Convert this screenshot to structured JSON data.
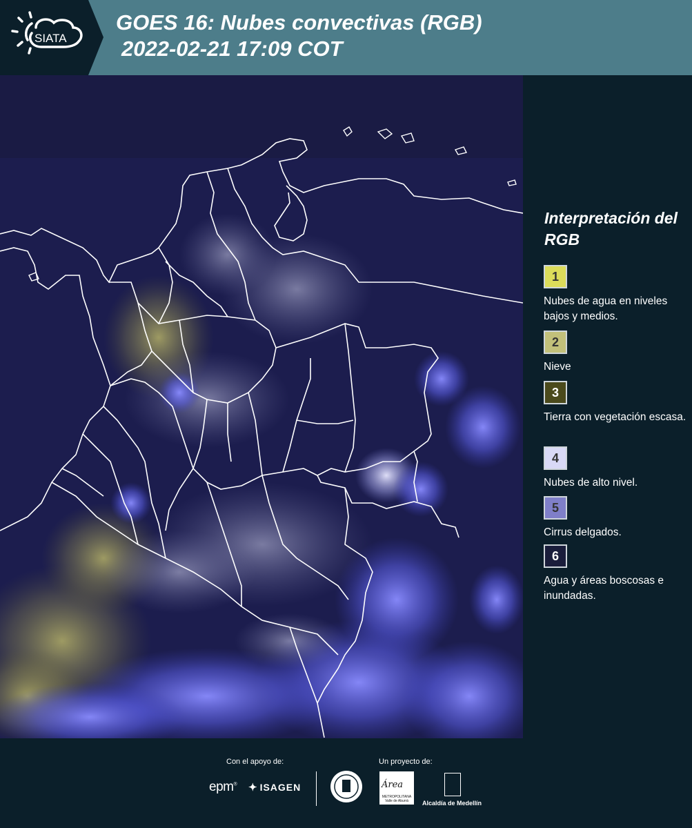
{
  "header": {
    "logo_text": "SIATA",
    "title_line1": "GOES 16: Nubes convectivas (RGB)",
    "title_line2": "2022-02-21 17:09 COT",
    "background_color": "#4d7d8a"
  },
  "map": {
    "region": "Colombia",
    "boundary_color": "#ffffff",
    "background_color": "#1b1c4c"
  },
  "legend": {
    "title": "Interpretación del RGB",
    "items": [
      {
        "number": "1",
        "color": "#dcdc5a",
        "label": "Nubes de agua en niveles bajos y medios."
      },
      {
        "number": "2",
        "color": "#c2c07a",
        "label": "Nieve"
      },
      {
        "number": "3",
        "color": "#4b4a1c",
        "label": "Tierra con vegetación escasa."
      },
      {
        "number": "4",
        "color": "#d9d9f6",
        "label": "Nubes de alto nivel."
      },
      {
        "number": "5",
        "color": "#7f7fc9",
        "label": "Cirrus delgados."
      },
      {
        "number": "6",
        "color": "#1a1d3b",
        "label": "Agua y áreas boscosas e inundadas."
      }
    ]
  },
  "footer": {
    "support_label": "Con el apoyo de:",
    "project_label": "Un proyecto de:",
    "sponsor1": "epm",
    "sponsor2": "ISAGEN",
    "partner1": "Área",
    "partner1_sub": "METROPOLITANA Valle de Aburrá",
    "partner2": "Alcaldía de Medellín"
  }
}
